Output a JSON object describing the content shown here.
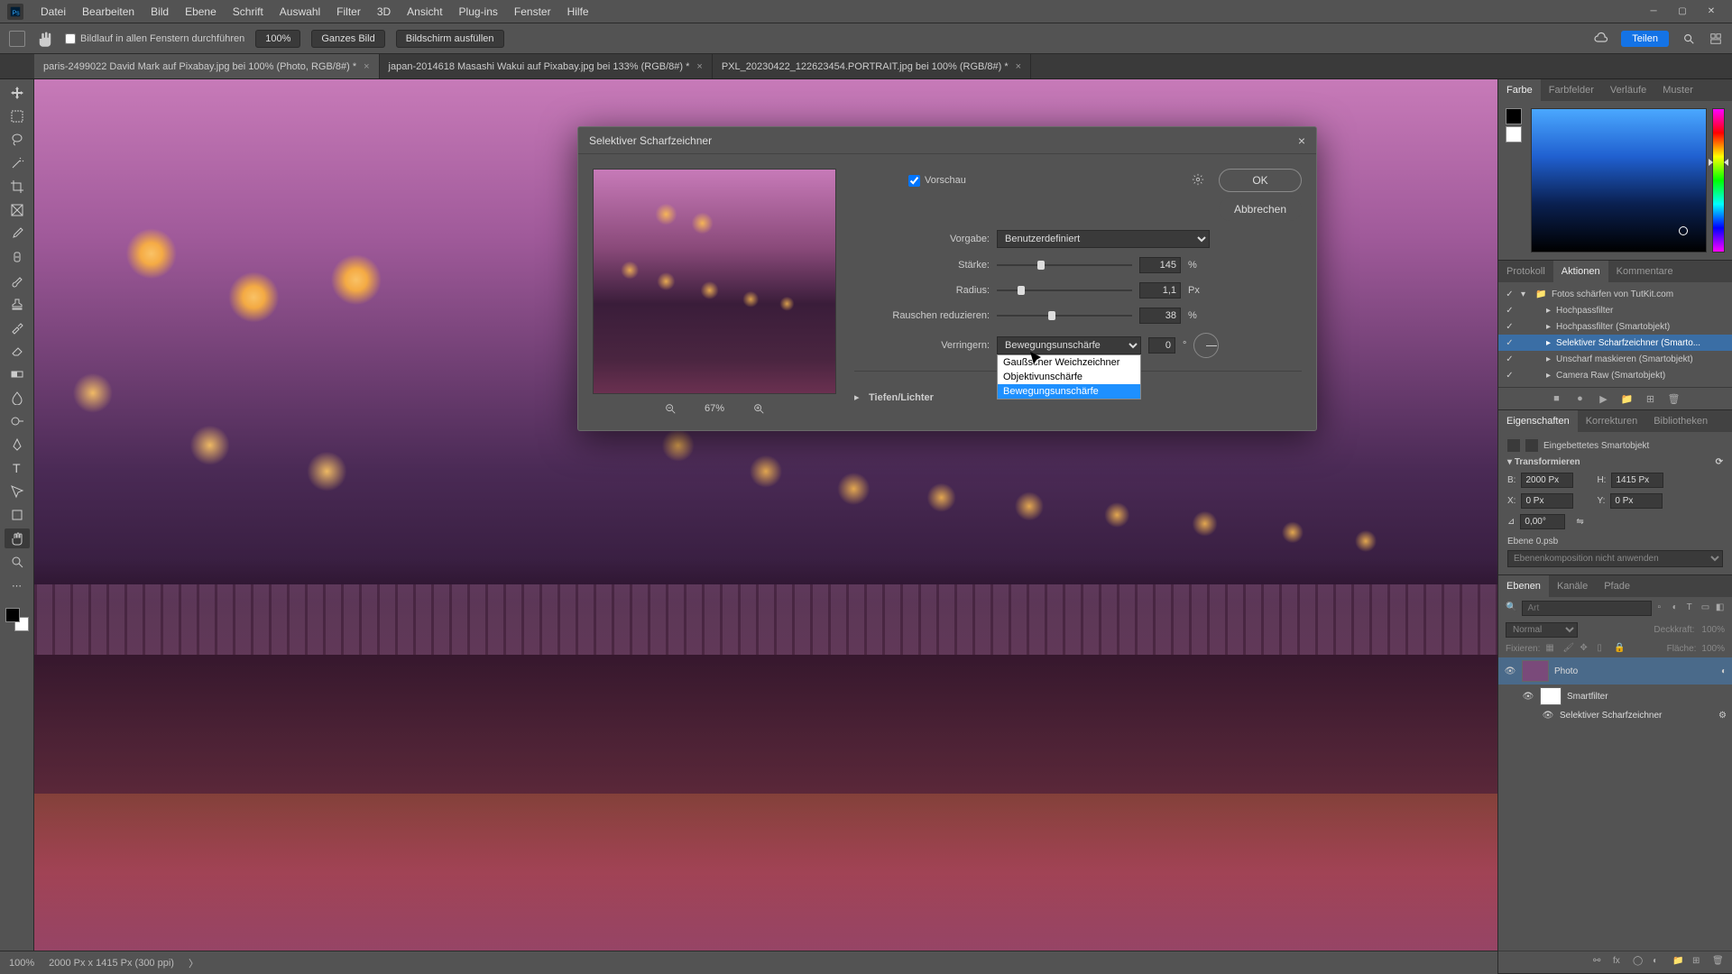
{
  "menu": {
    "items": [
      "Datei",
      "Bearbeiten",
      "Bild",
      "Ebene",
      "Schrift",
      "Auswahl",
      "Filter",
      "3D",
      "Ansicht",
      "Plug-ins",
      "Fenster",
      "Hilfe"
    ]
  },
  "options": {
    "scroll_all": "Bildlauf in allen Fenstern durchführen",
    "zoom": "100%",
    "fit": "Ganzes Bild",
    "fill": "Bildschirm ausfüllen",
    "share": "Teilen"
  },
  "tabs": [
    {
      "label": "paris-2499022  David Mark auf Pixabay.jpg bei 100% (Photo, RGB/8#) *",
      "active": true
    },
    {
      "label": "japan-2014618 Masashi Wakui auf Pixabay.jpg bei 133% (RGB/8#) *",
      "active": false
    },
    {
      "label": "PXL_20230422_122623454.PORTRAIT.jpg bei 100% (RGB/8#) *",
      "active": false
    }
  ],
  "dialog": {
    "title": "Selektiver Scharfzeichner",
    "preview": "Vorschau",
    "preset_label": "Vorgabe:",
    "preset_value": "Benutzerdefiniert",
    "amount_label": "Stärke:",
    "amount_value": "145",
    "amount_unit": "%",
    "radius_label": "Radius:",
    "radius_value": "1,1",
    "radius_unit": "Px",
    "noise_label": "Rauschen reduzieren:",
    "noise_value": "38",
    "noise_unit": "%",
    "remove_label": "Verringern:",
    "remove_value": "Bewegungsunschärfe",
    "remove_options": [
      "Gaußscher Weichzeichner",
      "Objektivunschärfe",
      "Bewegungsunschärfe"
    ],
    "angle_value": "0",
    "angle_unit": "°",
    "section": "Tiefen/Lichter",
    "ok": "OK",
    "cancel": "Abbrechen",
    "zoom": "67%"
  },
  "color_tabs": [
    "Farbe",
    "Farbfelder",
    "Verläufe",
    "Muster"
  ],
  "history_tabs": [
    "Protokoll",
    "Aktionen",
    "Kommentare"
  ],
  "actions": {
    "set": "Fotos schärfen von TutKit.com",
    "items": [
      "Hochpassfilter",
      "Hochpassfilter (Smartobjekt)",
      "Selektiver Scharfzeichner (Smarto...",
      "Unscharf maskieren (Smartobjekt)",
      "Camera Raw (Smartobjekt)"
    ]
  },
  "props_tabs": [
    "Eigenschaften",
    "Korrekturen",
    "Bibliotheken"
  ],
  "props": {
    "type": "Eingebettetes Smartobjekt",
    "transform": "Transformieren",
    "w_label": "B:",
    "w": "2000 Px",
    "h_label": "H:",
    "h": "1415 Px",
    "x_label": "X:",
    "x": "0 Px",
    "y_label": "Y:",
    "y": "0 Px",
    "angle": "0,00°",
    "layer_label": "Ebene 0.psb",
    "comp": "Ebenenkomposition nicht anwenden"
  },
  "layers_tabs": [
    "Ebenen",
    "Kanäle",
    "Pfade"
  ],
  "layers": {
    "search_placeholder": "Art",
    "blend": "Normal",
    "opacity_label": "Deckkraft:",
    "opacity": "100%",
    "lock_label": "Fixieren:",
    "fill_label": "Fläche:",
    "fill": "100%",
    "items": [
      {
        "name": "Photo",
        "type": "smart"
      },
      {
        "name": "Smartfilter",
        "type": "fx"
      },
      {
        "name": "Selektiver Scharfzeichner",
        "type": "filter"
      }
    ]
  },
  "status": {
    "zoom": "100%",
    "dims": "2000 Px x 1415 Px (300 ppi)"
  }
}
